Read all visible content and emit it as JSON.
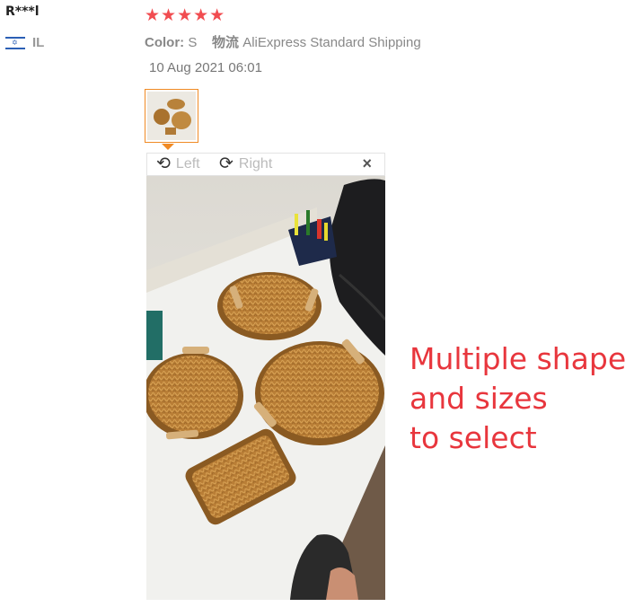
{
  "review": {
    "reviewer": "R***l",
    "country": "IL",
    "stars": "★★★★★",
    "color_label": "Color:",
    "color_value": "S",
    "shipping_label": "物流",
    "shipping_value": "AliExpress Standard Shipping",
    "date": "10 Aug 2021 06:01"
  },
  "viewer": {
    "rotate_left_label": "Left",
    "rotate_right_label": "Right",
    "close_glyph": "×"
  },
  "overlay_text": {
    "line1": "Multiple shape",
    "line2": "and sizes",
    "line3": "to select"
  },
  "colors": {
    "star": "#f14c50",
    "thumb_border": "#f08a24",
    "overlay": "#e8363d"
  },
  "icons": [
    "israel-flag-icon",
    "rotate-left-icon",
    "rotate-right-icon",
    "close-icon"
  ]
}
